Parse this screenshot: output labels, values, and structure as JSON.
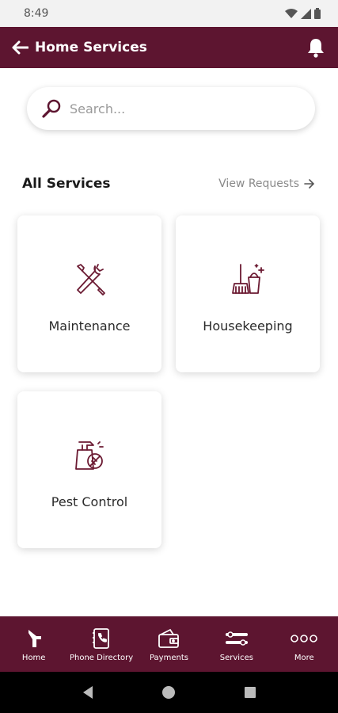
{
  "status": {
    "time": "8:49"
  },
  "header": {
    "title": "Home Services"
  },
  "search": {
    "placeholder": "Search..."
  },
  "section": {
    "title": "All Services",
    "view_requests": "View Requests"
  },
  "services": [
    {
      "label": "Maintenance",
      "icon": "tools-icon"
    },
    {
      "label": "Housekeeping",
      "icon": "cleaning-icon"
    },
    {
      "label": "Pest Control",
      "icon": "pest-spray-icon"
    }
  ],
  "bottom_nav": [
    {
      "label": "Home",
      "icon": "home-icon"
    },
    {
      "label": "Phone Directory",
      "icon": "phone-directory-icon"
    },
    {
      "label": "Payments",
      "icon": "wallet-icon"
    },
    {
      "label": "Services",
      "icon": "services-icon"
    },
    {
      "label": "More",
      "icon": "more-icon"
    }
  ],
  "colors": {
    "primary": "#5d1530",
    "accent_icon": "#6b1a32"
  }
}
